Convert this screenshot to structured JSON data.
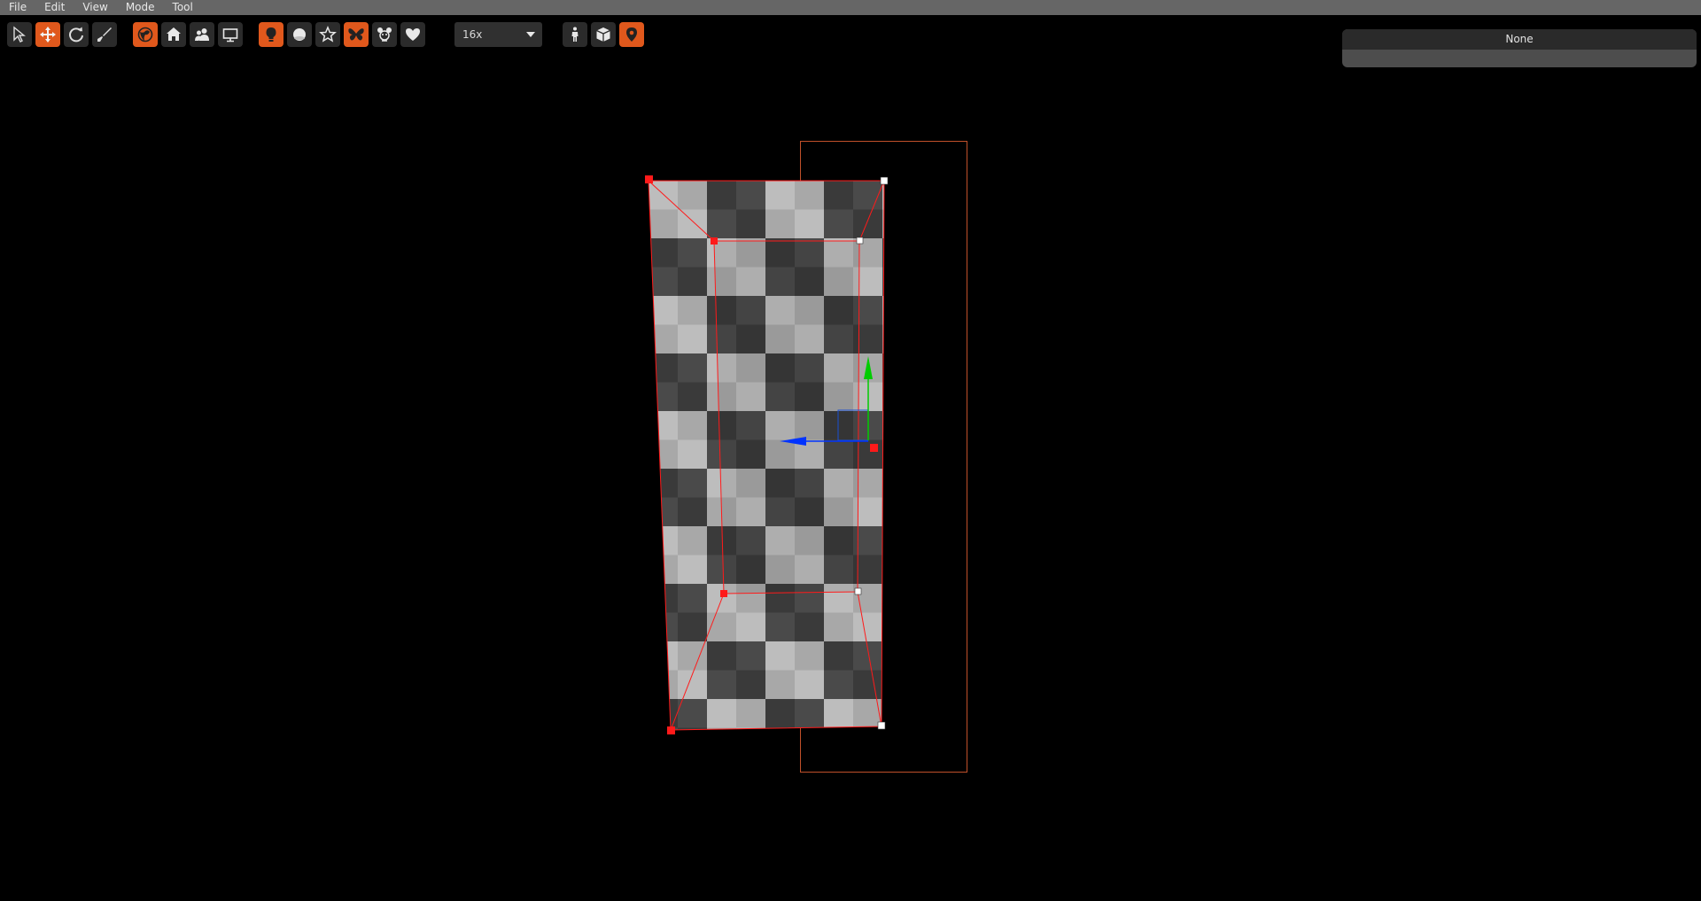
{
  "menu": {
    "file": "File",
    "edit": "Edit",
    "view": "View",
    "mode": "Mode",
    "tool": "Tool"
  },
  "toolbar": {
    "zoom_value": "16x",
    "groups": [
      [
        "select-tool-icon",
        "move-tool-icon",
        "rotate-tool-icon",
        "brush-tool-icon"
      ],
      [
        "globe-icon",
        "home-icon",
        "users-icon",
        "display-icon"
      ],
      [
        "light-bulb-icon",
        "sphere-icon",
        "star-icon",
        "butterfly-icon",
        "character-icon",
        "heart-icon"
      ],
      [
        "person-icon",
        "box-icon",
        "map-pin-icon"
      ]
    ]
  },
  "panel": {
    "title": "None"
  },
  "colors": {
    "accent": "#e0581c",
    "menubar": "#666666",
    "background": "#000000",
    "selection": "#ff0000",
    "gizmo_x": "#ff0000",
    "gizmo_y": "#00cc00",
    "gizmo_z": "#0033ff",
    "bounds": "#c0502a"
  }
}
